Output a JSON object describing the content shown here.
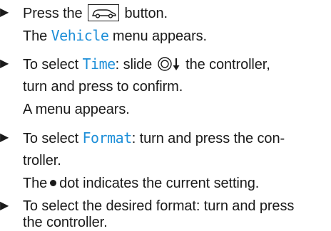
{
  "instructions": [
    {
      "bullet": "▶",
      "lines": [
        {
          "before": "Press the",
          "icon": "vehicle-button-icon",
          "after": "button."
        },
        {
          "text": "The ",
          "highlight": "Vehicle",
          "after": " menu appears."
        }
      ]
    },
    {
      "bullet": "▶",
      "lines": [
        {
          "before": "To select ",
          "highlight": "Time",
          "after_hl": ": slide ",
          "icon": "controller-slide-down-icon",
          "after": " the controller,"
        },
        {
          "text": "turn and press to confirm."
        },
        {
          "text": "A menu appears."
        }
      ]
    },
    {
      "bullet": "▶",
      "lines": [
        {
          "before": "To select ",
          "highlight": "Format",
          "after": ": turn and press the con-"
        },
        {
          "text": "troller."
        },
        {
          "before": "The",
          "icon": "current-setting-dot-icon",
          "after": "dot indicates the current setting."
        }
      ]
    },
    {
      "bullet": "▶",
      "lines": [
        {
          "text": "To select the desired format: turn and press"
        },
        {
          "text": "the controller."
        }
      ]
    }
  ],
  "colors": {
    "highlight": "#1e8fd8",
    "text": "#1a1a1a"
  }
}
